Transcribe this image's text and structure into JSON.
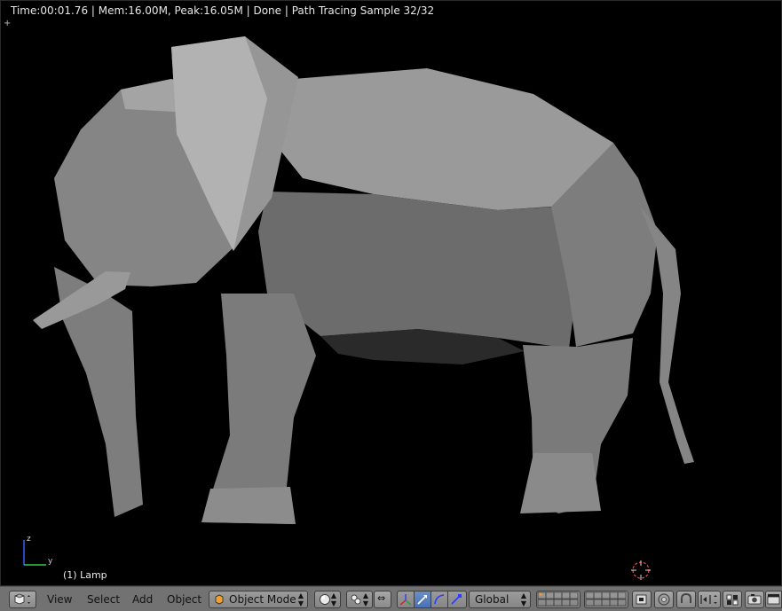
{
  "viewport": {
    "render_status": "Time:00:01.76 | Mem:16.00M, Peak:16.05M | Done | Path Tracing Sample 32/32",
    "active_object": "(1) Lamp",
    "axis": {
      "z": "z",
      "y": "y"
    }
  },
  "header": {
    "menus": {
      "view": "View",
      "select": "Select",
      "add": "Add",
      "object": "Object"
    },
    "mode": "Object Mode",
    "orientation": "Global"
  },
  "colors": {
    "header_bg": "#727272",
    "accent": "#4a72b2",
    "viewport_bg": "#000000"
  }
}
